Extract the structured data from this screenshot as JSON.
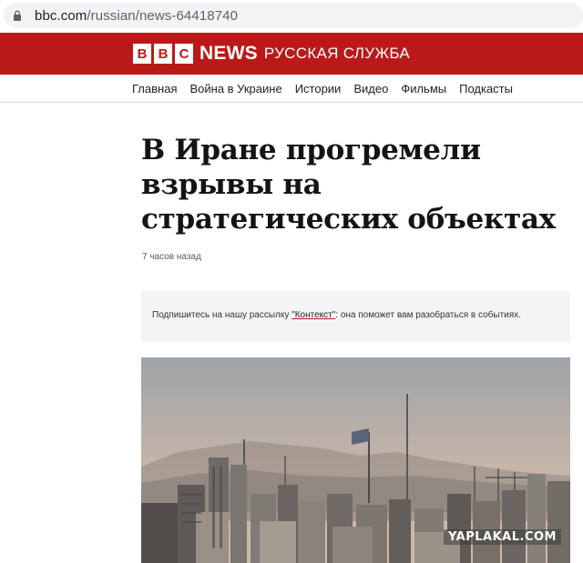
{
  "browser": {
    "url_host": "bbc.com",
    "url_path": "/russian/news-64418740"
  },
  "brand": {
    "letters": [
      "B",
      "B",
      "C"
    ],
    "news": "NEWS",
    "service": "РУССКАЯ СЛУЖБА",
    "color": "#bb1919"
  },
  "nav": {
    "items": [
      "Главная",
      "Война в Украине",
      "Истории",
      "Видео",
      "Фильмы",
      "Подкасты"
    ]
  },
  "article": {
    "headline": "В Иране прогремели взрывы на стратегических объектах",
    "timestamp": "7 часов назад"
  },
  "promo": {
    "text_before": "Подпишитесь на нашу рассылку ",
    "link_text": "\"Контекст\"",
    "text_after": ": она поможет вам разобраться в событиях."
  },
  "photo": {
    "watermark": "YAPLAKAL.COM"
  }
}
